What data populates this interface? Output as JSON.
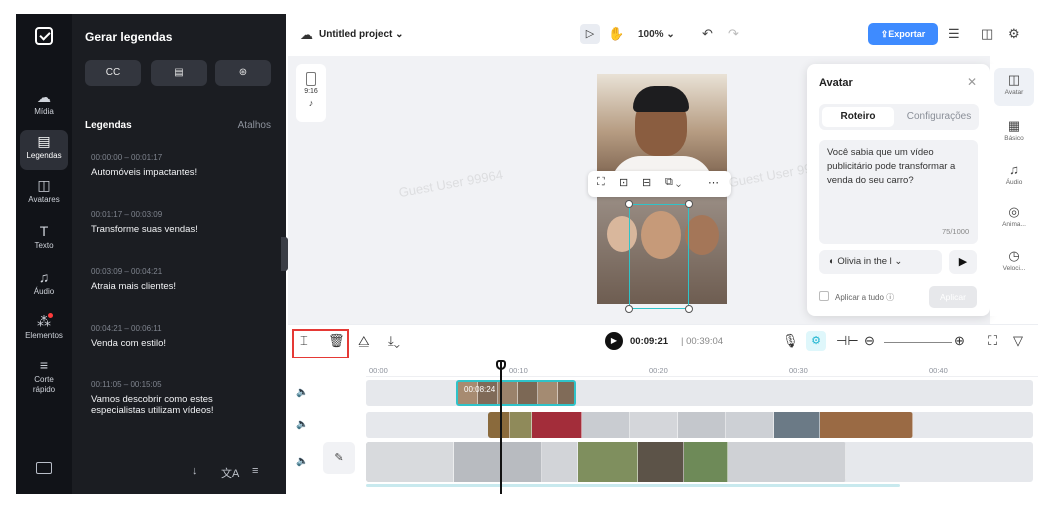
{
  "rail": {
    "items": [
      {
        "icon": "☁",
        "label": "Mídia"
      },
      {
        "icon": "▤",
        "label": "Legendas"
      },
      {
        "icon": "◫",
        "label": "Avatares"
      },
      {
        "icon": "T",
        "label": "Texto"
      },
      {
        "icon": "♫",
        "label": "Áudio"
      },
      {
        "icon": "⁂",
        "label": "Elementos"
      },
      {
        "icon": "≡",
        "label": "Corte\nrápido"
      }
    ]
  },
  "panel": {
    "title": "Gerar legendas",
    "buttons": [
      "CC",
      "▤",
      "⊛"
    ],
    "section_title": "Legendas",
    "shortcuts_label": "Atalhos",
    "captions": [
      {
        "time": "00:00:00 – 00:01:17",
        "text": "Automóveis impactantes!"
      },
      {
        "time": "00:01:17 – 00:03:09",
        "text": "Transforme suas vendas!"
      },
      {
        "time": "00:03:09 – 00:04:21",
        "text": "Atraia mais clientes!"
      },
      {
        "time": "00:04:21 – 00:06:11",
        "text": "Venda com estilo!"
      },
      {
        "time": "00:11:05 – 00:15:05",
        "text": "Vamos descobrir como estes especialistas utilizam vídeos!"
      }
    ],
    "footer_icons": [
      "↓",
      "文A",
      "≡"
    ]
  },
  "topbar": {
    "project_title": "Untitled project",
    "zoom": "100%",
    "export_label": "⇪Exportar"
  },
  "canvas": {
    "ratio": "9:16",
    "ratio_platform": "♪",
    "watermark": "Guest User 99964"
  },
  "avatar_panel": {
    "title": "Avatar",
    "tabs": [
      "Roteiro",
      "Configurações"
    ],
    "script_text": "Você sabia que um vídeo publicitário pode transformar a venda do seu carro?",
    "char_count": "75/1000",
    "voice": "Olivia in the l",
    "apply_all_label": "Aplicar a tudo ⓘ",
    "apply_button": "Aplicar"
  },
  "right_rail": {
    "items": [
      {
        "icon": "◫",
        "label": "Avatar"
      },
      {
        "icon": "▦",
        "label": "Básico"
      },
      {
        "icon": "♫",
        "label": "Áudio"
      },
      {
        "icon": "◎",
        "label": "Anima..."
      },
      {
        "icon": "◷",
        "label": "Veloci..."
      }
    ]
  },
  "timeline": {
    "current_time": "00:09:21",
    "total_time": "| 00:39:04",
    "ruler": [
      "00:00",
      "00:10",
      "00:20",
      "00:30",
      "00:40"
    ],
    "clip_tag": "00:08:24"
  }
}
